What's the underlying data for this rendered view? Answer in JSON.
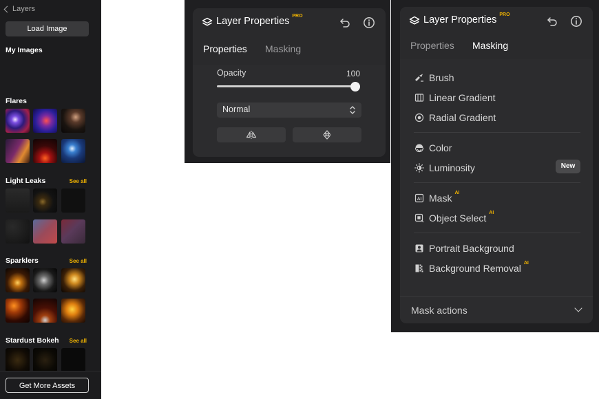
{
  "sidebar": {
    "back_label": "Layers",
    "load_button": "Load Image",
    "my_images": "My Images",
    "sections": [
      {
        "title": "Flares",
        "see_all": ""
      },
      {
        "title": "Light Leaks",
        "see_all": "See all"
      },
      {
        "title": "Sparklers",
        "see_all": "See all"
      },
      {
        "title": "Stardust Bokeh",
        "see_all": "See all"
      }
    ],
    "get_more_button": "Get More Assets"
  },
  "properties_panel": {
    "title": "Layer Properties",
    "pro_badge": "PRO",
    "tabs": [
      "Properties",
      "Masking"
    ],
    "active_tab": "Properties",
    "opacity_label": "Opacity",
    "opacity_value": "100",
    "blend_mode": "Normal"
  },
  "masking_panel": {
    "title": "Layer Properties",
    "pro_badge": "PRO",
    "tabs": [
      "Properties",
      "Masking"
    ],
    "active_tab": "Masking",
    "items": [
      {
        "label": "Brush",
        "icon": "brush-icon",
        "tag": ""
      },
      {
        "label": "Linear Gradient",
        "icon": "linear-gradient-icon",
        "tag": ""
      },
      {
        "label": "Radial Gradient",
        "icon": "radial-gradient-icon",
        "tag": ""
      },
      {
        "label": "Color",
        "icon": "color-icon",
        "tag": ""
      },
      {
        "label": "Luminosity",
        "icon": "luminosity-icon",
        "tag": ""
      },
      {
        "label": "Mask",
        "icon": "ai-mask-icon",
        "tag": "AI"
      },
      {
        "label": "Object Select",
        "icon": "object-select-icon",
        "tag": "AI"
      },
      {
        "label": "Portrait Background",
        "icon": "portrait-icon",
        "tag": ""
      },
      {
        "label": "Background Removal",
        "icon": "background-removal-icon",
        "tag": "AI"
      }
    ],
    "new_badge": "New",
    "mask_actions_label": "Mask actions"
  },
  "colors": {
    "accent": "#f2b400",
    "panel": "#2c2c2e",
    "sidebar": "#1c1c1e"
  }
}
